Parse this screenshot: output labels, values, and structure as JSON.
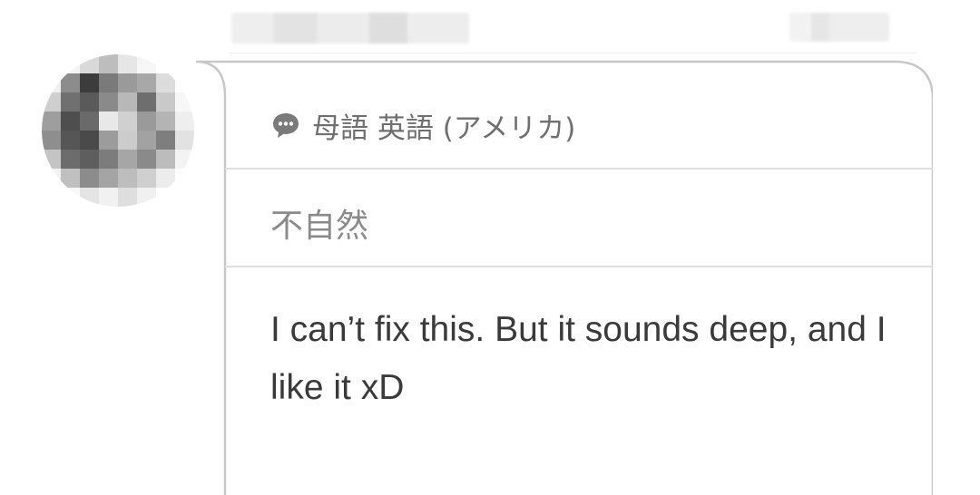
{
  "header": {
    "username_redacted": true,
    "timestamp_redacted": true
  },
  "avatar": {
    "redacted": true
  },
  "card": {
    "language_icon": "speech-bubble-icon",
    "native_language_label": "母語 英語 (アメリカ)",
    "verdict": "不自然",
    "comment": "I can’t fix this. But it sounds deep, and I like it xD"
  },
  "colors": {
    "background": "#ffffff",
    "card_border": "#c8c8c8",
    "divider": "#dedede",
    "label_text": "#6f6f6f",
    "verdict_text": "#8a8a8a",
    "body_text": "#3a3a3a"
  }
}
